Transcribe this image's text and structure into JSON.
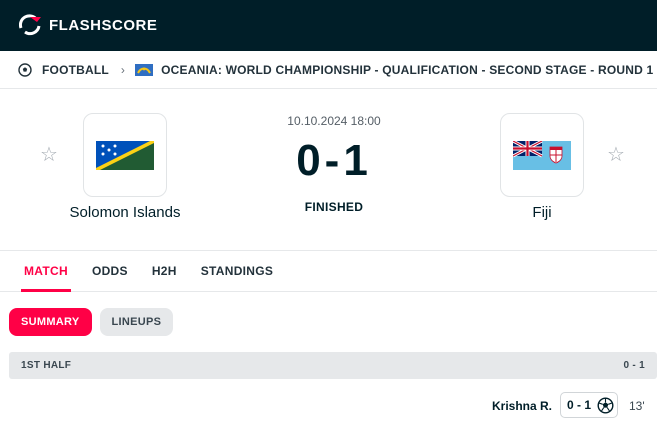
{
  "app": {
    "logo_text": "FLASHSCORE"
  },
  "breadcrumb": {
    "sport": "FOOTBALL",
    "competition": "OCEANIA: WORLD CHAMPIONSHIP - QUALIFICATION - SECOND STAGE - ROUND 1"
  },
  "match": {
    "datetime": "10.10.2024 18:00",
    "score": "0-1",
    "status": "FINISHED",
    "home": {
      "name": "Solomon Islands"
    },
    "away": {
      "name": "Fiji"
    }
  },
  "tabs": [
    {
      "label": "MATCH",
      "active": true
    },
    {
      "label": "ODDS"
    },
    {
      "label": "H2H"
    },
    {
      "label": "STANDINGS"
    }
  ],
  "subtabs": [
    {
      "label": "SUMMARY",
      "active": true
    },
    {
      "label": "LINEUPS"
    }
  ],
  "summary": {
    "half_label": "1ST HALF",
    "half_score": "0 - 1",
    "events": [
      {
        "player": "Krishna R.",
        "score": "0 - 1",
        "minute": "13'",
        "icon": "soccer-ball-icon"
      }
    ]
  },
  "colors": {
    "accent": "#ff0046",
    "header_bg": "#001e28"
  }
}
